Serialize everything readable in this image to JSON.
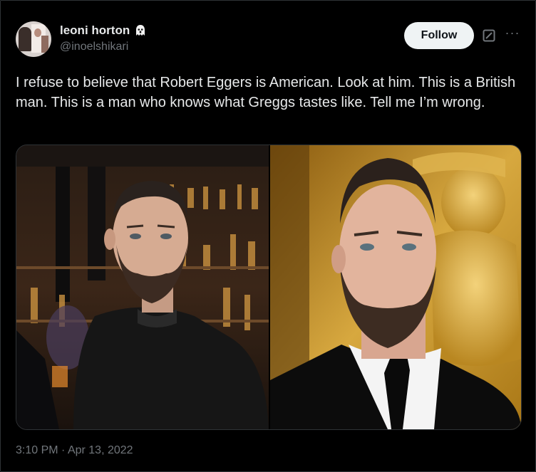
{
  "author": {
    "display_name": "leoni horton",
    "handle": "@inoelshikari",
    "name_emoji_icon": "ghost-icon"
  },
  "actions": {
    "follow_label": "Follow",
    "grok_icon": "grok-icon",
    "more_icon": "more-icon",
    "more_glyph": "···"
  },
  "tweet": {
    "text": "I refuse to believe that Robert Eggers is American. Look at him. This is a British man. This is a man who knows what Greggs tastes like. Tell me I’m wrong.",
    "time": "3:10 PM",
    "separator": " · ",
    "date": "Apr 13, 2022"
  },
  "colors": {
    "background": "#000000",
    "text_primary": "#e7e9ea",
    "text_secondary": "#71767b",
    "follow_button_bg": "#eff3f4",
    "border": "#2f3336"
  }
}
